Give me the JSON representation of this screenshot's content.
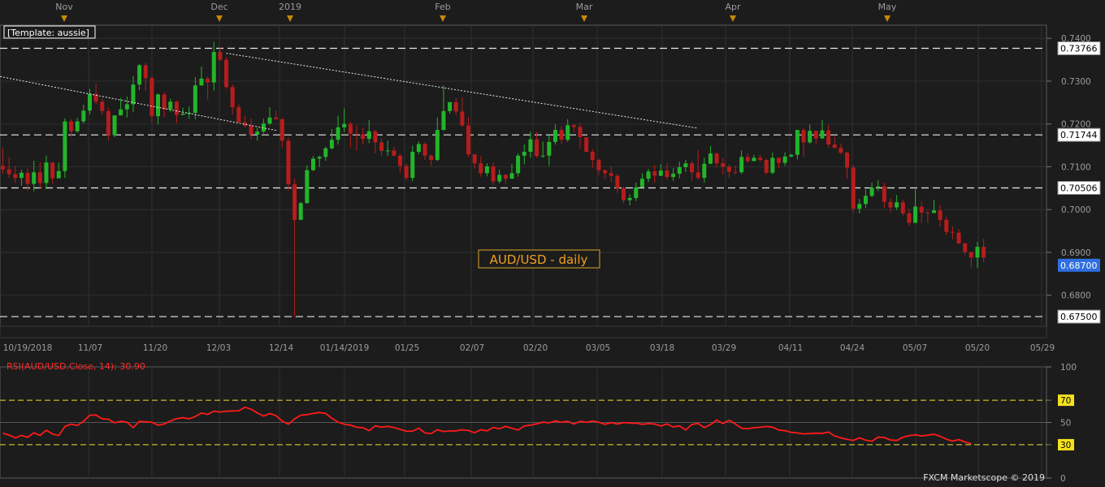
{
  "chart_data": [
    {
      "type": "candlestick",
      "title": "AUD/USD - daily",
      "template_label": "[Template: aussie]",
      "month_markers": [
        "Nov",
        "Dec",
        "2019",
        "Feb",
        "Mar",
        "Apr",
        "May"
      ],
      "x_ticks": [
        "10/19/2018",
        "11/07",
        "11/20",
        "12/03",
        "12/14",
        "01/14/2019",
        "01/25",
        "02/07",
        "02/20",
        "03/05",
        "03/18",
        "03/29",
        "04/11",
        "04/24",
        "05/07",
        "05/20",
        "05/29"
      ],
      "y_ticks": [
        "0.7400",
        "0.7300",
        "0.7200",
        "0.7100",
        "0.7000",
        "0.6900",
        "0.6800"
      ],
      "ylim": [
        0.6735,
        0.7425
      ],
      "horizontal_levels": [
        {
          "label": "0.73766",
          "value": 0.73766
        },
        {
          "label": "0.71744",
          "value": 0.71744
        },
        {
          "label": "0.70506",
          "value": 0.70506
        },
        {
          "label": "0.67500",
          "value": 0.675
        }
      ],
      "last_price": {
        "label": "0.68700",
        "value": 0.687
      },
      "candles": [
        [
          0.7102,
          0.7094,
          0.7145,
          0.7083
        ],
        [
          0.7094,
          0.7083,
          0.7123,
          0.7074
        ],
        [
          0.7083,
          0.7074,
          0.7102,
          0.7062
        ],
        [
          0.7074,
          0.7086,
          0.7093,
          0.7056
        ],
        [
          0.7086,
          0.706,
          0.7096,
          0.7044
        ],
        [
          0.706,
          0.7087,
          0.7114,
          0.7043
        ],
        [
          0.7087,
          0.7062,
          0.7111,
          0.7049
        ],
        [
          0.7062,
          0.711,
          0.7126,
          0.7048
        ],
        [
          0.711,
          0.7073,
          0.7111,
          0.706
        ],
        [
          0.7073,
          0.709,
          0.711,
          0.7075
        ],
        [
          0.709,
          0.7206,
          0.7213,
          0.7074
        ],
        [
          0.7206,
          0.7183,
          0.7211,
          0.717
        ],
        [
          0.7183,
          0.7206,
          0.7214,
          0.718
        ],
        [
          0.7206,
          0.7231,
          0.7245,
          0.7201
        ],
        [
          0.7231,
          0.727,
          0.7282,
          0.7222
        ],
        [
          0.727,
          0.7252,
          0.7294,
          0.7245
        ],
        [
          0.7252,
          0.723,
          0.7259,
          0.7222
        ],
        [
          0.723,
          0.7174,
          0.7238,
          0.7162
        ],
        [
          0.7174,
          0.722,
          0.722,
          0.7169
        ],
        [
          0.722,
          0.7234,
          0.7261,
          0.722
        ],
        [
          0.7234,
          0.7246,
          0.7264,
          0.7215
        ],
        [
          0.7246,
          0.7292,
          0.7312,
          0.7228
        ],
        [
          0.7292,
          0.7337,
          0.734,
          0.7279
        ],
        [
          0.7337,
          0.7307,
          0.7343,
          0.7277
        ],
        [
          0.7307,
          0.7218,
          0.7312,
          0.7203
        ],
        [
          0.7218,
          0.7269,
          0.7271,
          0.7199
        ],
        [
          0.7269,
          0.7234,
          0.7274,
          0.7215
        ],
        [
          0.7234,
          0.7252,
          0.7259,
          0.7228
        ],
        [
          0.7252,
          0.7221,
          0.7255,
          0.7202
        ],
        [
          0.7221,
          0.7224,
          0.7238,
          0.7223
        ],
        [
          0.7224,
          0.7226,
          0.7241,
          0.7212
        ],
        [
          0.7226,
          0.729,
          0.7309,
          0.7211
        ],
        [
          0.729,
          0.7306,
          0.7334,
          0.7289
        ],
        [
          0.7306,
          0.7297,
          0.7311,
          0.7257
        ],
        [
          0.7297,
          0.7368,
          0.7392,
          0.7278
        ],
        [
          0.7368,
          0.735,
          0.7379,
          0.7346
        ],
        [
          0.735,
          0.7286,
          0.7356,
          0.7282
        ],
        [
          0.7286,
          0.7239,
          0.7293,
          0.7221
        ],
        [
          0.7239,
          0.7204,
          0.7246,
          0.7204
        ],
        [
          0.7204,
          0.7196,
          0.7219,
          0.7191
        ],
        [
          0.7196,
          0.7175,
          0.7213,
          0.7164
        ],
        [
          0.7175,
          0.7182,
          0.7191,
          0.7161
        ],
        [
          0.7182,
          0.7201,
          0.7212,
          0.7178
        ],
        [
          0.7201,
          0.7215,
          0.7239,
          0.7197
        ],
        [
          0.7215,
          0.7211,
          0.7231,
          0.7211
        ],
        [
          0.7211,
          0.7161,
          0.7214,
          0.7145
        ],
        [
          0.7161,
          0.7059,
          0.7168,
          0.7045
        ],
        [
          0.7059,
          0.6976,
          0.7072,
          0.675
        ],
        [
          0.6976,
          0.7015,
          0.7018,
          0.6989
        ],
        [
          0.7015,
          0.7092,
          0.7103,
          0.7014
        ],
        [
          0.7092,
          0.7119,
          0.7125,
          0.709
        ],
        [
          0.7119,
          0.7123,
          0.7126,
          0.7099
        ],
        [
          0.7123,
          0.7143,
          0.7147,
          0.7114
        ],
        [
          0.7143,
          0.7163,
          0.7188,
          0.714
        ],
        [
          0.7163,
          0.7192,
          0.7219,
          0.7152
        ],
        [
          0.7192,
          0.72,
          0.7236,
          0.7181
        ],
        [
          0.72,
          0.7177,
          0.7206,
          0.7145
        ],
        [
          0.7177,
          0.7176,
          0.7196,
          0.7138
        ],
        [
          0.7176,
          0.7165,
          0.7192,
          0.7152
        ],
        [
          0.7165,
          0.7183,
          0.7209,
          0.7155
        ],
        [
          0.7183,
          0.7157,
          0.7186,
          0.7131
        ],
        [
          0.7157,
          0.7137,
          0.7166,
          0.7125
        ],
        [
          0.7137,
          0.7138,
          0.7161,
          0.7125
        ],
        [
          0.7138,
          0.7126,
          0.7147,
          0.7124
        ],
        [
          0.7126,
          0.7102,
          0.713,
          0.7086
        ],
        [
          0.7102,
          0.7074,
          0.7107,
          0.7068
        ],
        [
          0.7074,
          0.7135,
          0.7149,
          0.7066
        ],
        [
          0.7135,
          0.7153,
          0.7159,
          0.7129
        ],
        [
          0.7153,
          0.7126,
          0.7158,
          0.7116
        ],
        [
          0.7126,
          0.7116,
          0.7128,
          0.7102
        ],
        [
          0.7116,
          0.7186,
          0.7215,
          0.7113
        ],
        [
          0.7186,
          0.723,
          0.729,
          0.7185
        ],
        [
          0.723,
          0.7251,
          0.7251,
          0.7224
        ],
        [
          0.7251,
          0.7229,
          0.726,
          0.7221
        ],
        [
          0.7229,
          0.7196,
          0.7262,
          0.7194
        ],
        [
          0.7196,
          0.7129,
          0.7216,
          0.7123
        ],
        [
          0.7129,
          0.7108,
          0.7129,
          0.7096
        ],
        [
          0.7108,
          0.7085,
          0.7124,
          0.7077
        ],
        [
          0.7085,
          0.7101,
          0.7108,
          0.7078
        ],
        [
          0.7101,
          0.7066,
          0.711,
          0.7058
        ],
        [
          0.7066,
          0.7081,
          0.7093,
          0.7061
        ],
        [
          0.7081,
          0.7072,
          0.7084,
          0.706
        ],
        [
          0.7072,
          0.7085,
          0.7107,
          0.7072
        ],
        [
          0.7085,
          0.7126,
          0.7131,
          0.7077
        ],
        [
          0.7126,
          0.7135,
          0.7152,
          0.7106
        ],
        [
          0.7135,
          0.7164,
          0.7182,
          0.7121
        ],
        [
          0.7164,
          0.7125,
          0.7181,
          0.7121
        ],
        [
          0.7125,
          0.7126,
          0.7159,
          0.7121
        ],
        [
          0.7126,
          0.7158,
          0.7174,
          0.7102
        ],
        [
          0.7158,
          0.7186,
          0.7199,
          0.7152
        ],
        [
          0.7186,
          0.7163,
          0.7195,
          0.7153
        ],
        [
          0.7163,
          0.7197,
          0.7211,
          0.7158
        ],
        [
          0.7197,
          0.7193,
          0.72,
          0.718
        ],
        [
          0.7193,
          0.7169,
          0.7203,
          0.7142
        ],
        [
          0.7169,
          0.7135,
          0.7169,
          0.7134
        ],
        [
          0.7135,
          0.7116,
          0.7141,
          0.7098
        ],
        [
          0.7116,
          0.7092,
          0.7119,
          0.7081
        ],
        [
          0.7092,
          0.7085,
          0.7094,
          0.7071
        ],
        [
          0.7085,
          0.7079,
          0.7102,
          0.7064
        ],
        [
          0.7079,
          0.705,
          0.7084,
          0.7039
        ],
        [
          0.705,
          0.7022,
          0.7054,
          0.7015
        ],
        [
          0.7022,
          0.7027,
          0.7036,
          0.701
        ],
        [
          0.7027,
          0.7052,
          0.7063,
          0.702
        ],
        [
          0.7052,
          0.7072,
          0.7085,
          0.706
        ],
        [
          0.7072,
          0.7089,
          0.7095,
          0.7064
        ],
        [
          0.7089,
          0.7079,
          0.7104,
          0.7063
        ],
        [
          0.7079,
          0.7091,
          0.7106,
          0.7078
        ],
        [
          0.7091,
          0.7076,
          0.7109,
          0.707
        ],
        [
          0.7076,
          0.7084,
          0.7097,
          0.7067
        ],
        [
          0.7084,
          0.7099,
          0.7112,
          0.7073
        ],
        [
          0.7099,
          0.7108,
          0.7116,
          0.7088
        ],
        [
          0.7108,
          0.7087,
          0.7113,
          0.7067
        ],
        [
          0.7087,
          0.7074,
          0.7139,
          0.7069
        ],
        [
          0.7074,
          0.7107,
          0.7121,
          0.7063
        ],
        [
          0.7107,
          0.7131,
          0.7148,
          0.7106
        ],
        [
          0.7131,
          0.7108,
          0.7133,
          0.7099
        ],
        [
          0.7108,
          0.71,
          0.7121,
          0.7082
        ],
        [
          0.71,
          0.7088,
          0.7106,
          0.7074
        ],
        [
          0.7088,
          0.7087,
          0.7102,
          0.7081
        ],
        [
          0.7087,
          0.7123,
          0.7138,
          0.7083
        ],
        [
          0.7123,
          0.7113,
          0.7132,
          0.711
        ],
        [
          0.7113,
          0.7121,
          0.7128,
          0.7114
        ],
        [
          0.7121,
          0.7116,
          0.7128,
          0.7111
        ],
        [
          0.7116,
          0.7086,
          0.7119,
          0.7082
        ],
        [
          0.7086,
          0.7121,
          0.7133,
          0.7082
        ],
        [
          0.7121,
          0.7109,
          0.7122,
          0.7096
        ],
        [
          0.7109,
          0.7124,
          0.7134,
          0.7102
        ],
        [
          0.7124,
          0.7128,
          0.713,
          0.7122
        ],
        [
          0.7128,
          0.7186,
          0.7186,
          0.7117
        ],
        [
          0.7186,
          0.7157,
          0.7191,
          0.7123
        ],
        [
          0.7157,
          0.7184,
          0.7199,
          0.7153
        ],
        [
          0.7184,
          0.7166,
          0.7177,
          0.7153
        ],
        [
          0.7166,
          0.7185,
          0.7209,
          0.7176
        ],
        [
          0.7185,
          0.7152,
          0.7198,
          0.7145
        ],
        [
          0.7152,
          0.7144,
          0.717,
          0.7143
        ],
        [
          0.7144,
          0.7133,
          0.7154,
          0.7129
        ],
        [
          0.7133,
          0.7098,
          0.7135,
          0.7072
        ],
        [
          0.7098,
          0.7002,
          0.7105,
          0.6993
        ],
        [
          0.7002,
          0.7013,
          0.7025,
          0.6991
        ],
        [
          0.7013,
          0.7032,
          0.7047,
          0.7004
        ],
        [
          0.7032,
          0.7051,
          0.7063,
          0.7029
        ],
        [
          0.7051,
          0.7054,
          0.7069,
          0.7043
        ],
        [
          0.7054,
          0.7018,
          0.7063,
          0.7004
        ],
        [
          0.7018,
          0.7005,
          0.7026,
          0.6993
        ],
        [
          0.7005,
          0.7017,
          0.7034,
          0.6999
        ],
        [
          0.7017,
          0.6991,
          0.7023,
          0.6986
        ],
        [
          0.6991,
          0.6969,
          0.7001,
          0.6961
        ],
        [
          0.6969,
          0.7007,
          0.7047,
          0.6969
        ],
        [
          0.7007,
          0.6993,
          0.7019,
          0.6968
        ],
        [
          0.6993,
          0.6992,
          0.6997,
          0.6969
        ],
        [
          0.6992,
          0.6998,
          0.7023,
          0.6992
        ],
        [
          0.6998,
          0.6976,
          0.7011,
          0.696
        ],
        [
          0.6976,
          0.6948,
          0.6983,
          0.6941
        ],
        [
          0.6948,
          0.6946,
          0.6961,
          0.6931
        ],
        [
          0.6946,
          0.6921,
          0.6954,
          0.692
        ],
        [
          0.6921,
          0.6901,
          0.6922,
          0.6895
        ],
        [
          0.6901,
          0.6888,
          0.6899,
          0.6865
        ],
        [
          0.6888,
          0.6913,
          0.6925,
          0.6864
        ],
        [
          0.6913,
          0.6888,
          0.6932,
          0.6877
        ]
      ],
      "trendlines": [
        {
          "points": [
            [
              -3,
              0.7318
            ],
            [
              44,
              0.7185
            ]
          ]
        },
        {
          "points": [
            [
              36,
              0.7365
            ],
            [
              112,
              0.719
            ]
          ]
        }
      ],
      "up_color": "#22b52a",
      "down_color": "#b71c1c",
      "background": "#1c1c1c",
      "grid": true
    },
    {
      "type": "line",
      "title": "RSI(AUD/USD.Close, 14): 30.90",
      "y_ticks": [
        "100",
        "70",
        "50",
        "30",
        "0"
      ],
      "ylim": [
        0,
        100
      ],
      "levels": [
        70,
        50,
        30
      ],
      "series": [
        {
          "color": "#ff1a1a",
          "values": [
            40.4,
            38.7,
            36.2,
            38.4,
            36.7,
            40.7,
            38.3,
            43.0,
            39.6,
            38.3,
            46.4,
            48.5,
            47.3,
            51.1,
            56.5,
            56.7,
            53.3,
            52.9,
            49.7,
            51.0,
            50.3,
            45.3,
            51.0,
            50.6,
            50.2,
            47.6,
            48.6,
            51.4,
            53.4,
            54.3,
            53.3,
            55.3,
            58.5,
            57.3,
            60.2,
            59.4,
            60.1,
            60.4,
            60.5,
            63.7,
            61.9,
            58.6,
            55.8,
            58.0,
            56.2,
            51.3,
            48.4,
            53.2,
            56.6,
            57.1,
            58.2,
            59.0,
            58.1,
            53.9,
            50.3,
            48.5,
            47.6,
            45.7,
            45.3,
            42.6,
            46.9,
            45.8,
            46.5,
            45.5,
            43.8,
            42.1,
            42.2,
            44.8,
            40.6,
            40.1,
            43.4,
            41.9,
            42.3,
            42.5,
            43.4,
            42.8,
            40.7,
            43.5,
            42.5,
            45.5,
            44.4,
            46.5,
            44.8,
            43.2,
            46.8,
            47.6,
            48.7,
            50.3,
            49.6,
            51.4,
            50.2,
            51.0,
            48.6,
            51.0,
            50.2,
            51.3,
            50.3,
            48.3,
            49.9,
            48.6,
            49.9,
            49.5,
            49.4,
            48.3,
            49.0,
            48.6,
            46.8,
            48.7,
            46.0,
            46.9,
            43.2,
            48.2,
            49.1,
            45.4,
            48.1,
            52.1,
            49.0,
            52.0,
            48.7,
            44.8,
            44.4,
            45.3,
            45.7,
            46.4,
            45.8,
            43.2,
            42.6,
            41.2,
            40.6,
            39.7,
            40.1,
            40.4,
            40.2,
            41.4,
            37.9,
            36.1,
            34.8,
            33.9,
            36.2,
            34.1,
            33.1,
            36.8,
            36.5,
            34.2,
            33.8,
            36.7,
            38.2,
            38.9,
            37.8,
            38.6,
            39.4,
            37.7,
            34.9,
            33.3,
            34.6,
            32.5,
            30.9
          ]
        }
      ]
    }
  ],
  "watermark": "FXCM Marketscope © 2019"
}
